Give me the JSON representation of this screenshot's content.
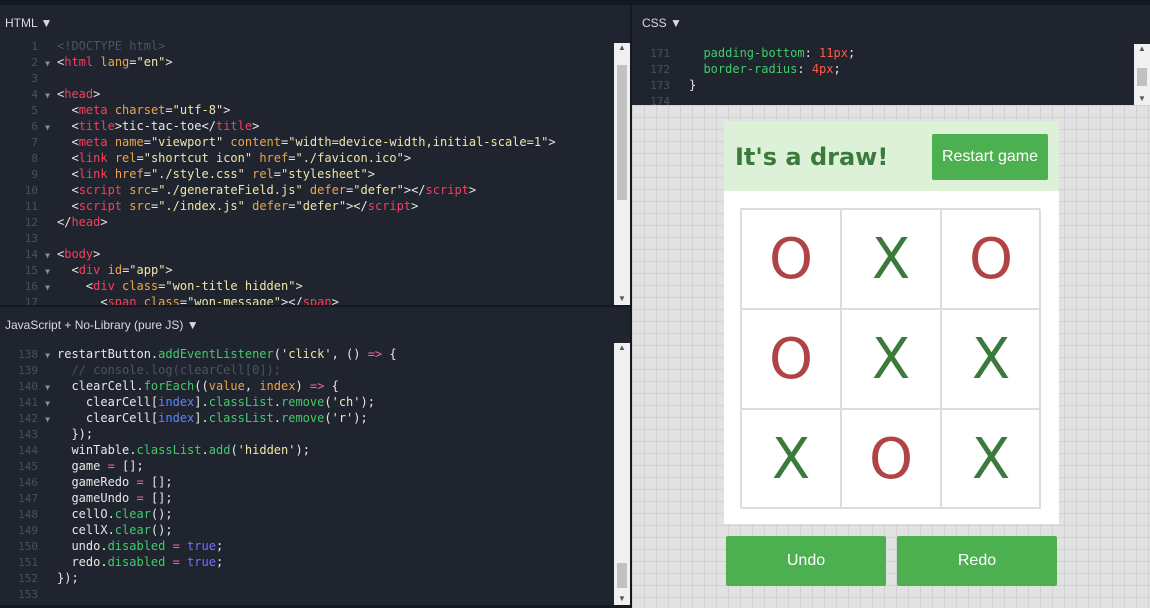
{
  "html_panel": {
    "label": "HTML ▼",
    "start": 1,
    "lines": [
      {
        "f": 0,
        "t": [
          [
            "com",
            "<!DOCTYPE html>"
          ]
        ]
      },
      {
        "f": 1,
        "t": [
          [
            "txt",
            "<"
          ],
          [
            "tag",
            "html"
          ],
          [
            "attr",
            " lang"
          ],
          [
            "txt",
            "="
          ],
          [
            "str",
            "\"en\""
          ],
          [
            "txt",
            ">"
          ]
        ]
      },
      {
        "f": 0,
        "t": []
      },
      {
        "f": 1,
        "t": [
          [
            "txt",
            "<"
          ],
          [
            "tag",
            "head"
          ],
          [
            "txt",
            ">"
          ]
        ]
      },
      {
        "f": 0,
        "t": [
          [
            "txt",
            "  <"
          ],
          [
            "tag",
            "meta"
          ],
          [
            "attr",
            " charset"
          ],
          [
            "txt",
            "="
          ],
          [
            "str",
            "\"utf-8\""
          ],
          [
            "txt",
            ">"
          ]
        ]
      },
      {
        "f": 1,
        "t": [
          [
            "txt",
            "  <"
          ],
          [
            "tag",
            "title"
          ],
          [
            "txt",
            ">tic-tac-toe</"
          ],
          [
            "tag",
            "title"
          ],
          [
            "txt",
            ">"
          ]
        ]
      },
      {
        "f": 0,
        "t": [
          [
            "txt",
            "  <"
          ],
          [
            "tag",
            "meta"
          ],
          [
            "attr",
            " name"
          ],
          [
            "txt",
            "="
          ],
          [
            "str",
            "\"viewport\""
          ],
          [
            "attr",
            " content"
          ],
          [
            "txt",
            "="
          ],
          [
            "str",
            "\"width=device-width,initial-scale=1\""
          ],
          [
            "txt",
            ">"
          ]
        ]
      },
      {
        "f": 0,
        "t": [
          [
            "txt",
            "  <"
          ],
          [
            "tag",
            "link"
          ],
          [
            "attr",
            " rel"
          ],
          [
            "txt",
            "="
          ],
          [
            "str",
            "\"shortcut icon\""
          ],
          [
            "attr",
            " href"
          ],
          [
            "txt",
            "="
          ],
          [
            "str",
            "\"./favicon.ico\""
          ],
          [
            "txt",
            ">"
          ]
        ]
      },
      {
        "f": 0,
        "t": [
          [
            "txt",
            "  <"
          ],
          [
            "tag",
            "link"
          ],
          [
            "attr",
            " href"
          ],
          [
            "txt",
            "="
          ],
          [
            "str",
            "\"./style.css\""
          ],
          [
            "attr",
            " rel"
          ],
          [
            "txt",
            "="
          ],
          [
            "str",
            "\"stylesheet\""
          ],
          [
            "txt",
            ">"
          ]
        ]
      },
      {
        "f": 0,
        "t": [
          [
            "txt",
            "  <"
          ],
          [
            "tag",
            "script"
          ],
          [
            "attr",
            " src"
          ],
          [
            "txt",
            "="
          ],
          [
            "str",
            "\"./generateField.js\""
          ],
          [
            "attr",
            " defer"
          ],
          [
            "txt",
            "="
          ],
          [
            "str",
            "\"defer\""
          ],
          [
            "txt",
            "></"
          ],
          [
            "tag",
            "script"
          ],
          [
            "txt",
            ">"
          ]
        ]
      },
      {
        "f": 0,
        "t": [
          [
            "txt",
            "  <"
          ],
          [
            "tag",
            "script"
          ],
          [
            "attr",
            " src"
          ],
          [
            "txt",
            "="
          ],
          [
            "str",
            "\"./index.js\""
          ],
          [
            "attr",
            " defer"
          ],
          [
            "txt",
            "="
          ],
          [
            "str",
            "\"defer\""
          ],
          [
            "txt",
            "></"
          ],
          [
            "tag",
            "script"
          ],
          [
            "txt",
            ">"
          ]
        ]
      },
      {
        "f": 0,
        "t": [
          [
            "txt",
            "</"
          ],
          [
            "tag",
            "head"
          ],
          [
            "txt",
            ">"
          ]
        ]
      },
      {
        "f": 0,
        "t": []
      },
      {
        "f": 1,
        "t": [
          [
            "txt",
            "<"
          ],
          [
            "tag",
            "body"
          ],
          [
            "txt",
            ">"
          ]
        ]
      },
      {
        "f": 1,
        "t": [
          [
            "txt",
            "  <"
          ],
          [
            "tag",
            "div"
          ],
          [
            "attr",
            " id"
          ],
          [
            "txt",
            "="
          ],
          [
            "str",
            "\"app\""
          ],
          [
            "txt",
            ">"
          ]
        ]
      },
      {
        "f": 1,
        "t": [
          [
            "txt",
            "    <"
          ],
          [
            "tag",
            "div"
          ],
          [
            "attr",
            " class"
          ],
          [
            "txt",
            "="
          ],
          [
            "str",
            "\"won-title hidden\""
          ],
          [
            "txt",
            ">"
          ]
        ]
      },
      {
        "f": 0,
        "t": [
          [
            "txt",
            "      <"
          ],
          [
            "tag",
            "span"
          ],
          [
            "attr",
            " class"
          ],
          [
            "txt",
            "="
          ],
          [
            "str",
            "\"won-message\""
          ],
          [
            "txt",
            "></"
          ],
          [
            "tag",
            "span"
          ],
          [
            "txt",
            ">"
          ]
        ]
      }
    ]
  },
  "js_panel": {
    "label": "JavaScript + No-Library (pure JS) ▼",
    "start": 138,
    "lines": [
      {
        "f": 1,
        "t": [
          [
            "txt",
            "restartButton."
          ],
          [
            "meth",
            "addEventListener"
          ],
          [
            "txt",
            "("
          ],
          [
            "str",
            "'click'"
          ],
          [
            "txt",
            ", () "
          ],
          [
            "op",
            "=>"
          ],
          [
            "txt",
            " {"
          ]
        ]
      },
      {
        "f": 0,
        "t": [
          [
            "com",
            "  // console.log(clearCell[0]);"
          ]
        ]
      },
      {
        "f": 1,
        "t": [
          [
            "txt",
            "  clearCell."
          ],
          [
            "meth",
            "forEach"
          ],
          [
            "txt",
            "(("
          ],
          [
            "attr",
            "value"
          ],
          [
            "txt",
            ", "
          ],
          [
            "attr",
            "index"
          ],
          [
            "txt",
            ") "
          ],
          [
            "op",
            "=>"
          ],
          [
            "txt",
            " {"
          ]
        ]
      },
      {
        "f": 1,
        "t": [
          [
            "txt",
            "    clearCell["
          ],
          [
            "var",
            "index"
          ],
          [
            "txt",
            "]."
          ],
          [
            "prop",
            "classList"
          ],
          [
            "txt",
            "."
          ],
          [
            "meth",
            "remove"
          ],
          [
            "txt",
            "("
          ],
          [
            "str",
            "'ch'"
          ],
          [
            "txt",
            ");"
          ]
        ]
      },
      {
        "f": 1,
        "t": [
          [
            "txt",
            "    clearCell["
          ],
          [
            "var",
            "index"
          ],
          [
            "txt",
            "]."
          ],
          [
            "prop",
            "classList"
          ],
          [
            "txt",
            "."
          ],
          [
            "meth",
            "remove"
          ],
          [
            "txt",
            "("
          ],
          [
            "str",
            "'r'"
          ],
          [
            "txt",
            ");"
          ]
        ]
      },
      {
        "f": 0,
        "t": [
          [
            "txt",
            "  });"
          ]
        ]
      },
      {
        "f": 0,
        "t": [
          [
            "txt",
            "  winTable."
          ],
          [
            "prop",
            "classList"
          ],
          [
            "txt",
            "."
          ],
          [
            "meth",
            "add"
          ],
          [
            "txt",
            "("
          ],
          [
            "str",
            "'hidden'"
          ],
          [
            "txt",
            ");"
          ]
        ]
      },
      {
        "f": 0,
        "t": [
          [
            "txt",
            "  game "
          ],
          [
            "op",
            "="
          ],
          [
            "txt",
            " [];"
          ]
        ]
      },
      {
        "f": 0,
        "t": [
          [
            "txt",
            "  gameRedo "
          ],
          [
            "op",
            "="
          ],
          [
            "txt",
            " [];"
          ]
        ]
      },
      {
        "f": 0,
        "t": [
          [
            "txt",
            "  gameUndo "
          ],
          [
            "op",
            "="
          ],
          [
            "txt",
            " [];"
          ]
        ]
      },
      {
        "f": 0,
        "t": [
          [
            "txt",
            "  cellO."
          ],
          [
            "meth",
            "clear"
          ],
          [
            "txt",
            "();"
          ]
        ]
      },
      {
        "f": 0,
        "t": [
          [
            "txt",
            "  cellX."
          ],
          [
            "meth",
            "clear"
          ],
          [
            "txt",
            "();"
          ]
        ]
      },
      {
        "f": 0,
        "t": [
          [
            "txt",
            "  undo."
          ],
          [
            "prop",
            "disabled"
          ],
          [
            "op",
            " ="
          ],
          [
            "kw",
            " true"
          ],
          [
            "txt",
            ";"
          ]
        ]
      },
      {
        "f": 0,
        "t": [
          [
            "txt",
            "  redo."
          ],
          [
            "prop",
            "disabled"
          ],
          [
            "op",
            " ="
          ],
          [
            "kw",
            " true"
          ],
          [
            "txt",
            ";"
          ]
        ]
      },
      {
        "f": 0,
        "t": [
          [
            "txt",
            "});"
          ]
        ]
      },
      {
        "f": 0,
        "t": []
      }
    ]
  },
  "css_panel": {
    "label": "CSS ▼",
    "start": 171,
    "lines": [
      {
        "f": 0,
        "t": [
          [
            "meth",
            "  padding-bottom"
          ],
          [
            "txt",
            ": "
          ],
          [
            "num",
            "11px"
          ],
          [
            "txt",
            ";"
          ]
        ]
      },
      {
        "f": 0,
        "t": [
          [
            "meth",
            "  border-radius"
          ],
          [
            "txt",
            ": "
          ],
          [
            "num",
            "4px"
          ],
          [
            "txt",
            ";"
          ]
        ]
      },
      {
        "f": 0,
        "t": [
          [
            "txt",
            "}"
          ]
        ]
      },
      {
        "f": 0,
        "t": []
      }
    ]
  },
  "preview": {
    "title": "It's a draw!",
    "restart_label": "Restart game",
    "undo_label": "Undo",
    "redo_label": "Redo",
    "board": [
      "O",
      "X",
      "O",
      "O",
      "X",
      "X",
      "X",
      "O",
      "X"
    ]
  },
  "colors": {
    "accent": "#4caf50",
    "o_mark": "#b04444",
    "x_mark": "#3a7a3a",
    "header_bg": "#dcf1d8"
  }
}
